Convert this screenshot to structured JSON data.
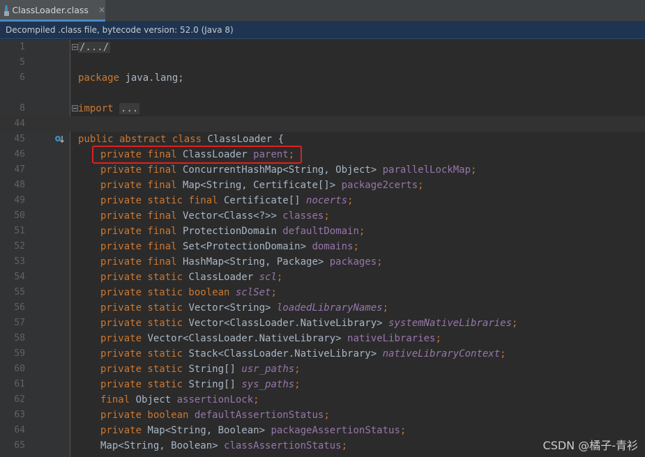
{
  "tab": {
    "icon": "class-file-icon",
    "label": "ClassLoader.class",
    "close": "×"
  },
  "banner": {
    "text": "Decompiled .class file, bytecode version: 52.0 (Java 8)"
  },
  "lines": {
    "l1": {
      "num": "1",
      "fold": "/.../"
    },
    "l5": {
      "num": "5"
    },
    "l6": {
      "num": "6",
      "kw": "package",
      "rest": " java.lang;"
    },
    "l8": {
      "num": "8",
      "kw": "import",
      "fold": "..."
    },
    "l44": {
      "num": "44"
    },
    "l45": {
      "num": "45",
      "kw": "public abstract class",
      "rest": " ClassLoader {"
    },
    "l46": {
      "num": "46",
      "kw": "private final",
      "type": " ClassLoader ",
      "field": "parent",
      "end": ";"
    },
    "l47": {
      "num": "47",
      "kw": "private final",
      "type": " ConcurrentHashMap<String, Object> ",
      "field": "parallelLockMap",
      "end": ";"
    },
    "l48": {
      "num": "48",
      "kw": "private final",
      "type": " Map<String, Certificate[]> ",
      "field": "package2certs",
      "end": ";"
    },
    "l49": {
      "num": "49",
      "kw": "private static final",
      "type": " Certificate[] ",
      "field": "nocerts",
      "end": ";"
    },
    "l50": {
      "num": "50",
      "kw": "private final",
      "type": " Vector<Class<?>> ",
      "field": "classes",
      "end": ";"
    },
    "l51": {
      "num": "51",
      "kw": "private final",
      "type": " ProtectionDomain ",
      "field": "defaultDomain",
      "end": ";"
    },
    "l52": {
      "num": "52",
      "kw": "private final",
      "type": " Set<ProtectionDomain> ",
      "field": "domains",
      "end": ";"
    },
    "l53": {
      "num": "53",
      "kw": "private final",
      "type": " HashMap<String, Package> ",
      "field": "packages",
      "end": ";"
    },
    "l54": {
      "num": "54",
      "kw": "private static",
      "type": " ClassLoader ",
      "field": "scl",
      "end": ";"
    },
    "l55": {
      "num": "55",
      "kw": "private static boolean",
      "type": " ",
      "field": "sclSet",
      "end": ";"
    },
    "l56": {
      "num": "56",
      "kw": "private static",
      "type": " Vector<String> ",
      "field": "loadedLibraryNames",
      "end": ";"
    },
    "l57": {
      "num": "57",
      "kw": "private static",
      "type": " Vector<ClassLoader.NativeLibrary> ",
      "field": "systemNativeLibraries",
      "end": ";"
    },
    "l58": {
      "num": "58",
      "kw": "private",
      "type": " Vector<ClassLoader.NativeLibrary> ",
      "field": "nativeLibraries",
      "end": ";"
    },
    "l59": {
      "num": "59",
      "kw": "private static",
      "type": " Stack<ClassLoader.NativeLibrary> ",
      "field": "nativeLibraryContext",
      "end": ";"
    },
    "l60": {
      "num": "60",
      "kw": "private static",
      "type": " String[] ",
      "field": "usr_paths",
      "end": ";"
    },
    "l61": {
      "num": "61",
      "kw": "private static",
      "type": " String[] ",
      "field": "sys_paths",
      "end": ";"
    },
    "l62": {
      "num": "62",
      "kw": "final",
      "type": " Object ",
      "field": "assertionLock",
      "end": ";"
    },
    "l63": {
      "num": "63",
      "kw": "private boolean",
      "type": " ",
      "field": "defaultAssertionStatus",
      "end": ";"
    },
    "l64": {
      "num": "64",
      "kw": "private",
      "type": " Map<String, Boolean> ",
      "field": "packageAssertionStatus",
      "end": ";"
    },
    "l65": {
      "num": "65",
      "kw": "",
      "type": "Map<String, Boolean> ",
      "field": "classAssertionStatus",
      "end": ";"
    }
  },
  "watermark": "CSDN @橘子-青衫",
  "colors": {
    "keyword": "#cc7832",
    "field": "#9876aa",
    "text": "#a9b7c6",
    "highlight": "#e02020",
    "banner": "#1e3450"
  }
}
